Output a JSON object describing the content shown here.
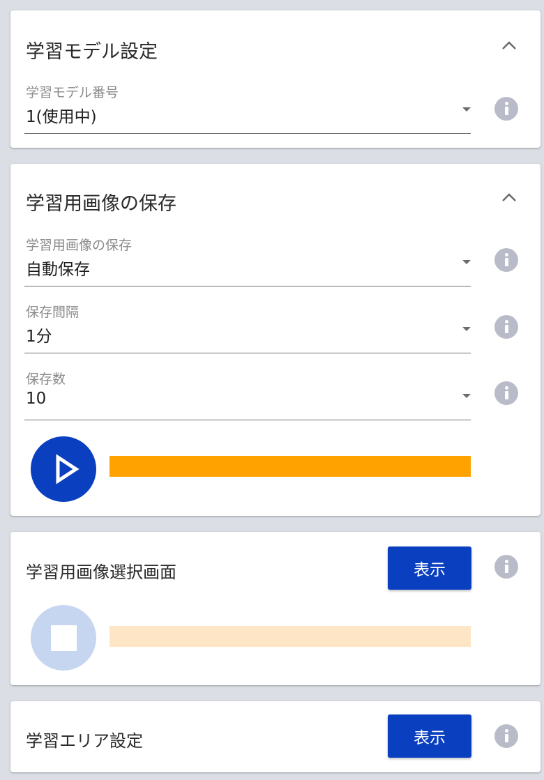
{
  "model_settings": {
    "title": "学習モデル設定",
    "model_number": {
      "label": "学習モデル番号",
      "value": "1(使用中)"
    }
  },
  "image_saving": {
    "title": "学習用画像の保存",
    "save_mode": {
      "label": "学習用画像の保存",
      "value": "自動保存"
    },
    "save_interval": {
      "label": "保存間隔",
      "value": "1分"
    },
    "save_count": {
      "label": "保存数",
      "value": "10"
    },
    "progress": {
      "value_percent": 100,
      "color": "#ffa200"
    }
  },
  "image_selection": {
    "title": "学習用画像選択画面",
    "show_button": "表示",
    "progress": {
      "value_percent": 100,
      "color": "#fde5c5"
    }
  },
  "area_settings": {
    "title": "学習エリア設定",
    "show_button": "表示"
  },
  "colors": {
    "primary": "#0a3fbf",
    "primary_disabled": "#c6d6f1",
    "info_icon": "#b9bcc8",
    "background": "#dcdee6"
  },
  "icons": {
    "collapse": "chevron-up-icon",
    "info": "info-icon",
    "play": "play-icon",
    "stop": "stop-icon",
    "dropdown": "dropdown-arrow-icon"
  }
}
